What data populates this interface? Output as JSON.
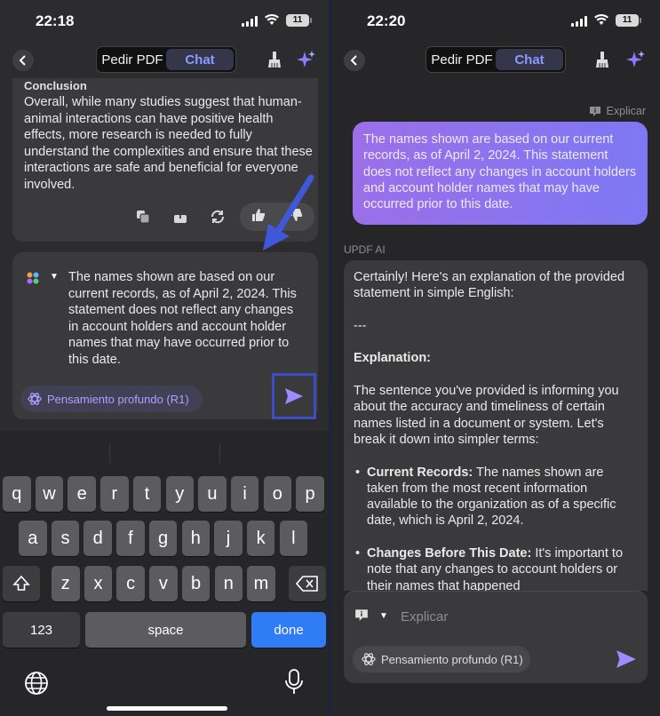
{
  "left": {
    "status": {
      "time": "22:18",
      "battery": "11"
    },
    "header": {
      "tab_pdf": "Pedir PDF",
      "tab_chat": "Chat"
    },
    "ai_message": {
      "title": "Conclusion",
      "text": "Overall, while many studies suggest that human-animal interactions can have positive health effects, more research is needed to fully understand the complexities and ensure that these interactions are safe and beneficial for everyone involved."
    },
    "input": {
      "text": "The names shown are based on our current records, as of April 2, 2024. This statement does not reflect any changes in account holders and account holder names that may have occurred prior to this date.",
      "deep_thinking": "Pensamiento profundo (R1)"
    },
    "keyboard": {
      "row1": [
        "q",
        "w",
        "e",
        "r",
        "t",
        "y",
        "u",
        "i",
        "o",
        "p"
      ],
      "row2": [
        "a",
        "s",
        "d",
        "f",
        "g",
        "h",
        "j",
        "k",
        "l"
      ],
      "row3": [
        "z",
        "x",
        "c",
        "v",
        "b",
        "n",
        "m"
      ],
      "numbers": "123",
      "space": "space",
      "done": "done"
    }
  },
  "right": {
    "status": {
      "time": "22:20",
      "battery": "11"
    },
    "header": {
      "tab_pdf": "Pedir PDF",
      "tab_chat": "Chat"
    },
    "explain_tag": "Explicar",
    "user_message": "The names shown are based on our current records, as of April 2, 2024. This statement does not reflect any changes in account holders and account holder names that may have occurred prior to this date.",
    "ai_label": "UPDF AI",
    "response": {
      "intro": "Certainly! Here's an explanation of the provided statement in simple English:",
      "sep": "---",
      "heading": "Explanation:",
      "para": "The sentence you've provided is informing you about the accuracy and timeliness of certain names listed in a document or system. Let's break it down into simpler terms:",
      "bullets": [
        {
          "bold": "Current Records:",
          "text": " The names shown are taken from the most recent information available to the organization as of a specific date, which is April 2, 2024."
        },
        {
          "bold": "Changes Before This Date:",
          "text": " It's important to note that any changes to account holders or their names that happened"
        }
      ]
    },
    "input": {
      "placeholder": "Explicar",
      "deep_thinking": "Pensamiento profundo (R1)"
    }
  },
  "colors": {
    "accent": "#8a9bff",
    "send": "#9b8cff",
    "done_key": "#2f7cf6",
    "highlight_box": "#3b4ec6"
  }
}
